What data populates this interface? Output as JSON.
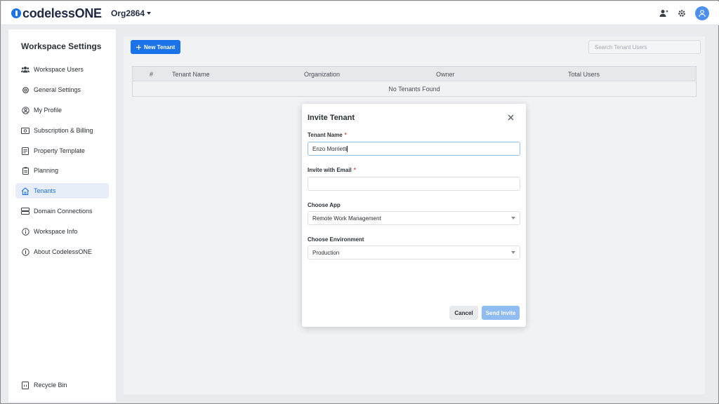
{
  "app": {
    "logo_text": "codelessONE",
    "org_name": "Org2864"
  },
  "top_icons": [
    "add-user-icon",
    "gear-icon",
    "user-avatar-icon"
  ],
  "sidebar": {
    "title": "Workspace Settings",
    "items": [
      {
        "label": "Workspace Users",
        "icon": "users-icon"
      },
      {
        "label": "General Settings",
        "icon": "gear-icon"
      },
      {
        "label": "My Profile",
        "icon": "profile-icon"
      },
      {
        "label": "Subscription & Billing",
        "icon": "billing-icon"
      },
      {
        "label": "Property Template",
        "icon": "template-icon"
      },
      {
        "label": "Planning",
        "icon": "clipboard-icon"
      },
      {
        "label": "Tenants",
        "icon": "home-icon",
        "active": true
      },
      {
        "label": "Domain Connections",
        "icon": "server-icon"
      },
      {
        "label": "Workspace Info",
        "icon": "info-icon"
      },
      {
        "label": "About CodelessONE",
        "icon": "about-icon"
      }
    ],
    "footer_item": {
      "label": "Recycle Bin",
      "icon": "recycle-bin-icon"
    }
  },
  "main": {
    "new_button_label": "New Tenant",
    "search_placeholder": "Search Tenant Users",
    "table": {
      "columns": [
        "#",
        "Tenant Name",
        "Organization",
        "Owner",
        "Total Users"
      ],
      "empty_text": "No Tenants Found"
    }
  },
  "modal": {
    "title": "Invite Tenant",
    "tenant_name_label": "Tenant Name",
    "tenant_name_value": "Enzo Morrietti",
    "email_label": "Invite with Email",
    "email_value": "",
    "app_label": "Choose App",
    "app_value": "Remote Work Management",
    "env_label": "Choose Environment",
    "env_value": "Production",
    "required_mark": "*",
    "cancel_label": "Cancel",
    "send_label": "Send Invite"
  },
  "colors": {
    "accent": "#1a73e8",
    "send_disabled": "#8fbcf3",
    "required": "#e04646"
  }
}
